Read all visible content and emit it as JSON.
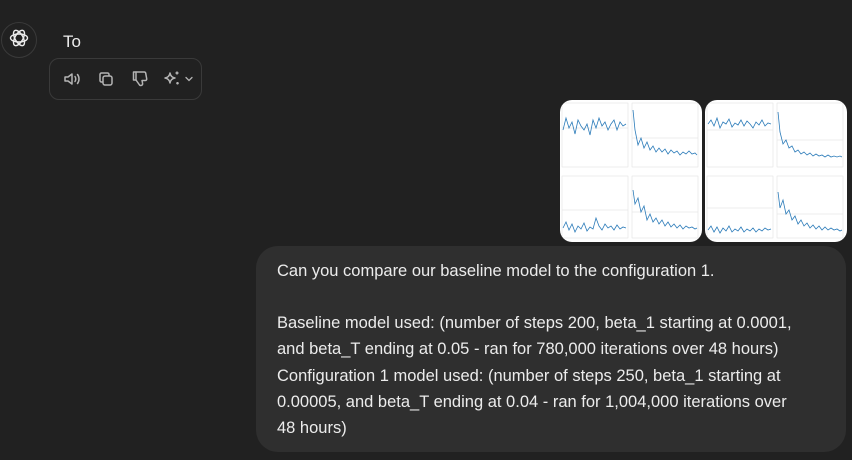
{
  "assistant": {
    "avatar_icon": "openai-logo-icon",
    "message_text": "To"
  },
  "toolbar": {
    "buttons": [
      {
        "name": "read-aloud-button",
        "icon": "speaker-icon"
      },
      {
        "name": "copy-button",
        "icon": "copy-icon"
      },
      {
        "name": "bad-response-button",
        "icon": "thumbs-down-icon"
      },
      {
        "name": "switch-model-button",
        "icon": "sparkle-icon"
      }
    ]
  },
  "attachments": [
    {
      "name": "chart-image-1",
      "kind": "training-plots-grid"
    },
    {
      "name": "chart-image-2",
      "kind": "training-plots-grid"
    }
  ],
  "user_message": {
    "line1": "Can you compare our baseline model to the configuration 1.",
    "para2_line1": "Baseline model used: (number of steps 200, beta_1 starting at 0.0001,",
    "para2_line2": "and beta_T ending at 0.05 - ran for 780,000 iterations over 48 hours)",
    "para3_line1": "Configuration 1 model used: (number of steps 250, beta_1 starting at",
    "para3_line2": "0.00005, and beta_T ending at 0.04 - ran for 1,004,000 iterations over",
    "para3_line3": "48 hours)"
  },
  "colors": {
    "background": "#212121",
    "bubble": "#2f2f2f",
    "text": "#ececec",
    "icon": "#b4b4b4"
  }
}
